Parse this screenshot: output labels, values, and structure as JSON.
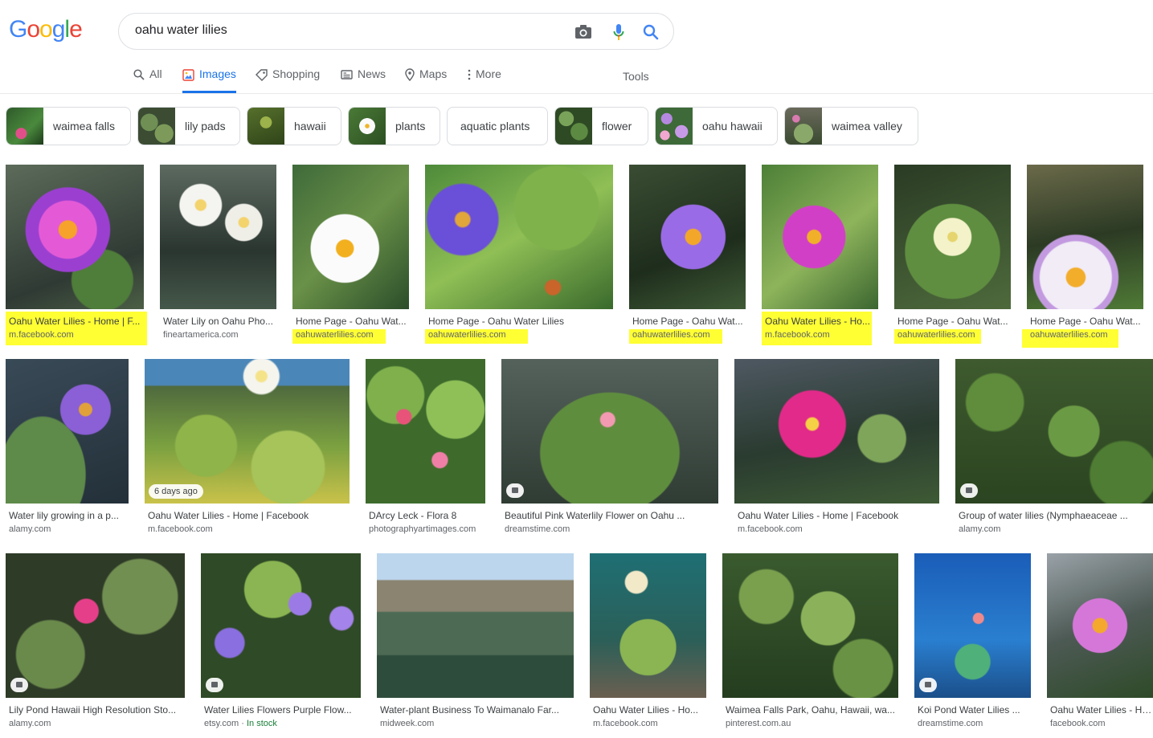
{
  "logo": {
    "letters": [
      "G",
      "o",
      "o",
      "g",
      "l",
      "e"
    ],
    "colors": [
      "#4285f4",
      "#ea4335",
      "#fbbc05",
      "#4285f4",
      "#34a853",
      "#ea4335"
    ]
  },
  "search": {
    "query": "oahu water lilies"
  },
  "tabs": [
    {
      "label": "All",
      "icon": "search-icon"
    },
    {
      "label": "Images",
      "icon": "image-icon"
    },
    {
      "label": "Shopping",
      "icon": "tag-icon"
    },
    {
      "label": "News",
      "icon": "newspaper-icon"
    },
    {
      "label": "Maps",
      "icon": "map-pin-icon"
    },
    {
      "label": "More",
      "icon": "more-vert-icon"
    }
  ],
  "tools_label": "Tools",
  "chips": [
    {
      "label": "waimea falls"
    },
    {
      "label": "lily pads"
    },
    {
      "label": "hawaii"
    },
    {
      "label": "plants"
    },
    {
      "label": "aquatic plants"
    },
    {
      "label": "flower"
    },
    {
      "label": "oahu hawaii"
    },
    {
      "label": "waimea valley"
    }
  ],
  "results": [
    {
      "title": "Oahu Water Lilies - Home | F...",
      "source": "m.facebook.com"
    },
    {
      "title": "Water Lily on Oahu Pho...",
      "source": "fineartamerica.com"
    },
    {
      "title": "Home Page - Oahu Wat...",
      "source": "oahuwaterlilies.com"
    },
    {
      "title": "Home Page - Oahu Water Lilies",
      "source": "oahuwaterlilies.com"
    },
    {
      "title": "Home Page - Oahu Wat...",
      "source": "oahuwaterlilies.com"
    },
    {
      "title": "Oahu Water Lilies - Ho...",
      "source": "m.facebook.com"
    },
    {
      "title": "Home Page - Oahu Wat...",
      "source": "oahuwaterlilies.com"
    },
    {
      "title": "Home Page - Oahu Wat...",
      "source": "oahuwaterlilies.com"
    },
    {
      "title": "Water lily growing in a p...",
      "source": "alamy.com"
    },
    {
      "title": "Oahu Water Lilies - Home | Facebook",
      "source": "m.facebook.com",
      "badge": "6 days ago"
    },
    {
      "title": "DArcy Leck - Flora 8",
      "source": "photographyartimages.com"
    },
    {
      "title": "Beautiful Pink Waterlily Flower on Oahu ...",
      "source": "dreamstime.com"
    },
    {
      "title": "Oahu Water Lilies - Home | Facebook",
      "source": "m.facebook.com"
    },
    {
      "title": "Group of water lilies (Nymphaeaceae ...",
      "source": "alamy.com"
    },
    {
      "title": "Lily Pond Hawaii High Resolution Sto...",
      "source": "alamy.com"
    },
    {
      "title": "Water Lilies Flowers Purple Flow...",
      "source": "etsy.com",
      "stock": "In stock"
    },
    {
      "title": "Water-plant Business To Waimanalo Far...",
      "source": "midweek.com"
    },
    {
      "title": "Oahu Water Lilies - Ho...",
      "source": "m.facebook.com"
    },
    {
      "title": "Waimea Falls Park, Oahu, Hawaii, wa...",
      "source": "pinterest.com.au"
    },
    {
      "title": "Koi Pond Water Lilies ...",
      "source": "dreamstime.com"
    },
    {
      "title": "Oahu Water Lilies - Ho...",
      "source": "facebook.com"
    }
  ],
  "colors": {
    "accent": "#1a73e8",
    "highlight": "#ffff33"
  }
}
